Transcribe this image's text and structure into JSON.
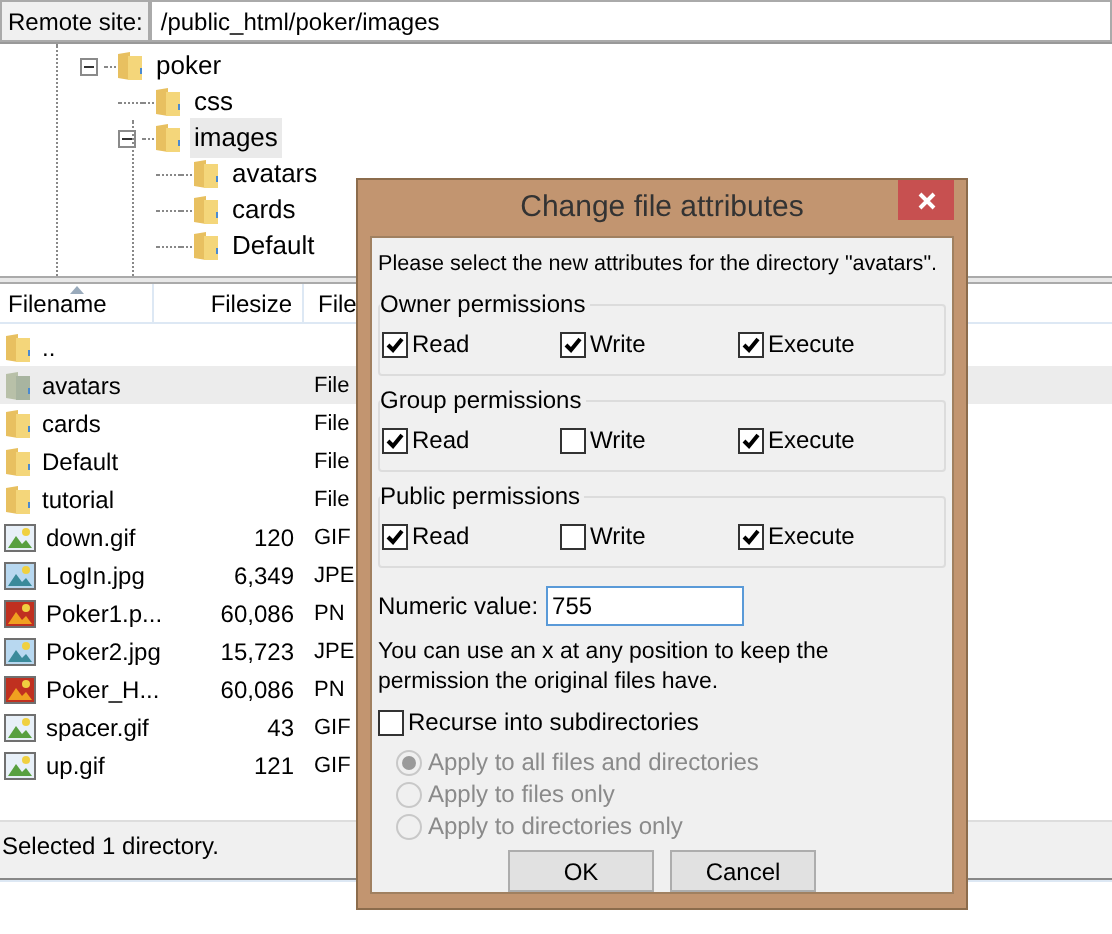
{
  "remote_site": {
    "label": "Remote site:",
    "path": "/public_html/poker/images"
  },
  "tree": [
    {
      "name": "poker",
      "expanded": true,
      "selected": false,
      "children": [
        {
          "name": "css",
          "selected": false
        },
        {
          "name": "images",
          "expanded": true,
          "selected": true,
          "children": [
            {
              "name": "avatars",
              "selected": false
            },
            {
              "name": "cards",
              "selected": false
            },
            {
              "name": "Default",
              "selected": false
            }
          ]
        }
      ]
    }
  ],
  "file_list": {
    "columns": [
      "Filename",
      "Filesize",
      "File"
    ],
    "rows": [
      {
        "kind": "folder",
        "name": "..",
        "selected": false
      },
      {
        "kind": "folder",
        "name": "avatars",
        "type": "File",
        "selected": true
      },
      {
        "kind": "folder",
        "name": "cards",
        "type": "File",
        "selected": false
      },
      {
        "kind": "folder",
        "name": "Default",
        "type": "File",
        "selected": false
      },
      {
        "kind": "folder",
        "name": "tutorial",
        "type": "File",
        "selected": false
      },
      {
        "kind": "gif",
        "name": "down.gif",
        "size": "120",
        "type": "GIF",
        "selected": false
      },
      {
        "kind": "jpg",
        "name": "LogIn.jpg",
        "size": "6,349",
        "type": "JPE",
        "selected": false
      },
      {
        "kind": "png",
        "name": "Poker1.p...",
        "size": "60,086",
        "type": "PN",
        "selected": false
      },
      {
        "kind": "jpg",
        "name": "Poker2.jpg",
        "size": "15,723",
        "type": "JPE",
        "selected": false
      },
      {
        "kind": "png",
        "name": "Poker_H...",
        "size": "60,086",
        "type": "PN",
        "selected": false
      },
      {
        "kind": "gif",
        "name": "spacer.gif",
        "size": "43",
        "type": "GIF",
        "selected": false
      },
      {
        "kind": "gif",
        "name": "up.gif",
        "size": "121",
        "type": "GIF",
        "selected": false
      }
    ]
  },
  "status_bar": "Selected 1 directory.",
  "dialog": {
    "title": "Change file attributes",
    "intro": "Please select the new attributes for the directory \"avatars\".",
    "groups": [
      {
        "title": "Owner permissions",
        "permissions": [
          {
            "label": "Read",
            "checked": true
          },
          {
            "label": "Write",
            "checked": true
          },
          {
            "label": "Execute",
            "checked": true
          }
        ]
      },
      {
        "title": "Group permissions",
        "permissions": [
          {
            "label": "Read",
            "checked": true
          },
          {
            "label": "Write",
            "checked": false
          },
          {
            "label": "Execute",
            "checked": true
          }
        ]
      },
      {
        "title": "Public permissions",
        "permissions": [
          {
            "label": "Read",
            "checked": true
          },
          {
            "label": "Write",
            "checked": false
          },
          {
            "label": "Execute",
            "checked": true
          }
        ]
      }
    ],
    "numeric": {
      "label": "Numeric value:",
      "value": "755"
    },
    "note": "You can use an x at any position to keep the permission the original files have.",
    "recurse": {
      "label": "Recurse into subdirectories",
      "checked": false
    },
    "apply_options": [
      {
        "label": "Apply to all files and directories",
        "selected": true,
        "disabled": true
      },
      {
        "label": "Apply to files only",
        "selected": false,
        "disabled": true
      },
      {
        "label": "Apply to directories only",
        "selected": false,
        "disabled": true
      }
    ],
    "buttons": [
      "OK",
      "Cancel"
    ]
  }
}
